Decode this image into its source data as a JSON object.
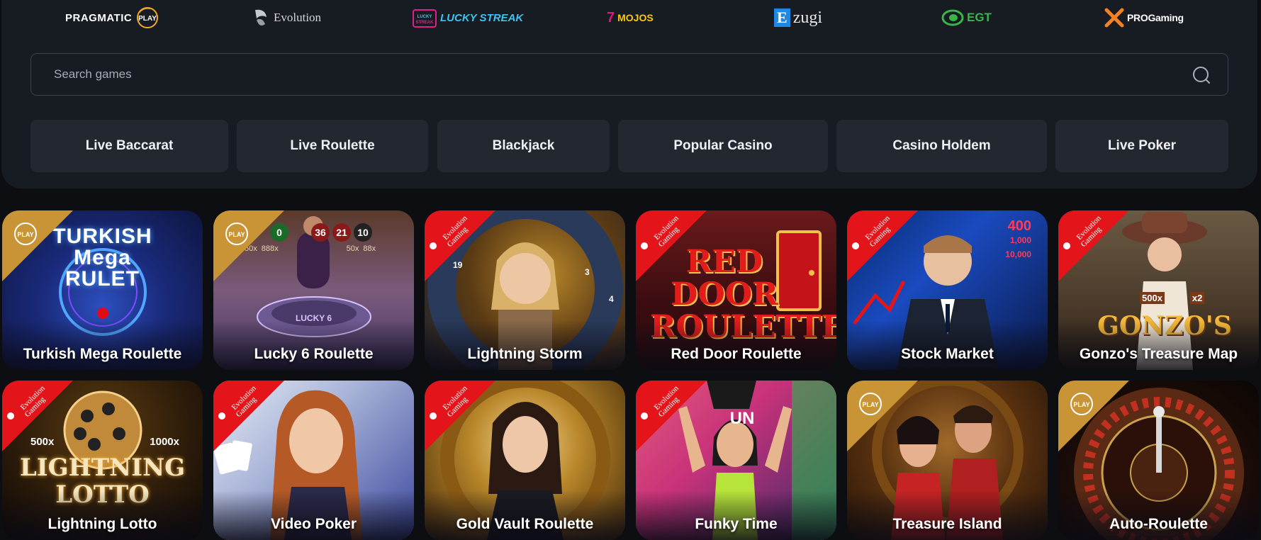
{
  "providers": [
    {
      "name": "PRAGMATIC",
      "sub": "PLAY"
    },
    {
      "name": "Evolution"
    },
    {
      "name": "LUCKY STREAK",
      "sub": "LUCKY STREAK"
    },
    {
      "name": "MOJOS",
      "sub": "7"
    },
    {
      "name": "zugi",
      "sub": "E"
    },
    {
      "name": "EGT"
    },
    {
      "name": "PROGaming",
      "sub": "PRO"
    }
  ],
  "search": {
    "placeholder": "Search games",
    "value": ""
  },
  "categories": [
    "Live Baccarat",
    "Live Roulette",
    "Blackjack",
    "Popular Casino",
    "Casino Holdem",
    "Live Poker"
  ],
  "games": [
    {
      "title": "Turkish Mega Roulette",
      "badge": "PLAY",
      "art": "TURKISH Mega RULET"
    },
    {
      "title": "Lucky 6 Roulette",
      "badge": "PLAY",
      "art": "LUCKY 6",
      "numbers": [
        "0",
        "36",
        "21",
        "10"
      ],
      "multipliers": [
        "50x",
        "888x",
        "50x",
        "88x"
      ]
    },
    {
      "title": "Lightning Storm",
      "badge": "Evolution Gaming",
      "art": "",
      "wheel": [
        "19",
        "3",
        "4"
      ]
    },
    {
      "title": "Red Door Roulette",
      "badge": "Evolution Gaming",
      "art": "RED DOOR ROULETTE"
    },
    {
      "title": "Stock Market",
      "badge": "Evolution Gaming",
      "art": "",
      "ticker": [
        "400",
        "1,000",
        "10,000"
      ]
    },
    {
      "title": "Gonzo's Treasure Map",
      "badge": "Evolution Gaming",
      "art": "GONZO'S",
      "multipliers": [
        "500x",
        "x2"
      ]
    },
    {
      "title": "Lightning Lotto",
      "badge": "Evolution Gaming",
      "art": "LIGHTNING LOTTO",
      "multipliers": [
        "500x",
        "1000x"
      ]
    },
    {
      "title": "Video Poker",
      "badge": "Evolution Gaming",
      "art": ""
    },
    {
      "title": "Gold Vault Roulette",
      "badge": "Evolution Gaming",
      "art": ""
    },
    {
      "title": "Funky Time",
      "badge": "Evolution Gaming",
      "art": "UN"
    },
    {
      "title": "Treasure Island",
      "badge": "PLAY",
      "art": ""
    },
    {
      "title": "Auto-Roulette",
      "badge": "PLAY",
      "art": ""
    }
  ],
  "colors": {
    "pragmatic": "#f7a823",
    "evolution_badge": "#e3151b",
    "lucky": "#e0218a",
    "mojos": "#e2167e",
    "ezugi": "#1e88e5",
    "egt": "#39b54a",
    "progaming": "#f58220"
  }
}
